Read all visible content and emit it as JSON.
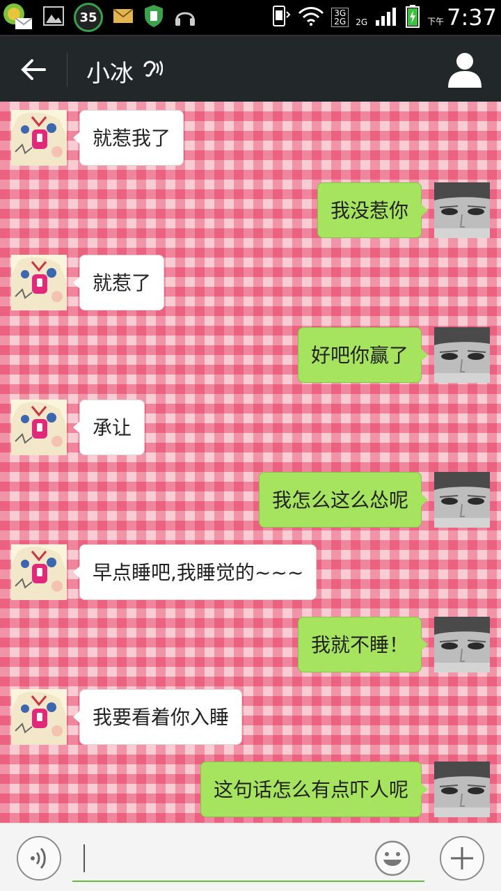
{
  "status_bar": {
    "notification_count": "35",
    "network_top": "3G",
    "network_bottom": "2G",
    "network_2g": "2G",
    "ampm": "下午",
    "time": "7:37"
  },
  "header": {
    "title": "小冰"
  },
  "messages": [
    {
      "side": "left",
      "text": "就惹我了"
    },
    {
      "side": "right",
      "text": "我没惹你"
    },
    {
      "side": "left",
      "text": "就惹了"
    },
    {
      "side": "right",
      "text": "好吧你赢了"
    },
    {
      "side": "left",
      "text": "承让"
    },
    {
      "side": "right",
      "text": "我怎么这么怂呢"
    },
    {
      "side": "left",
      "text": "早点睡吧,我睡觉的~~~"
    },
    {
      "side": "right",
      "text": "我就不睡！"
    },
    {
      "side": "left",
      "text": "我要看着你入睡"
    },
    {
      "side": "right",
      "text": "这句话怎么有点吓人呢"
    }
  ],
  "input": {
    "value": "",
    "placeholder": ""
  },
  "colors": {
    "titlebar": "#222829",
    "bubble_right": "#a6e35e",
    "bubble_left": "#ffffff",
    "background_pink": "#f7b9c4",
    "accent_green": "#5fbf3a"
  },
  "icons": {
    "back": "arrow-left-icon",
    "ear": "ear-icon",
    "profile": "person-icon",
    "voice": "voice-icon",
    "emoji": "smiley-icon",
    "plus": "plus-icon"
  }
}
